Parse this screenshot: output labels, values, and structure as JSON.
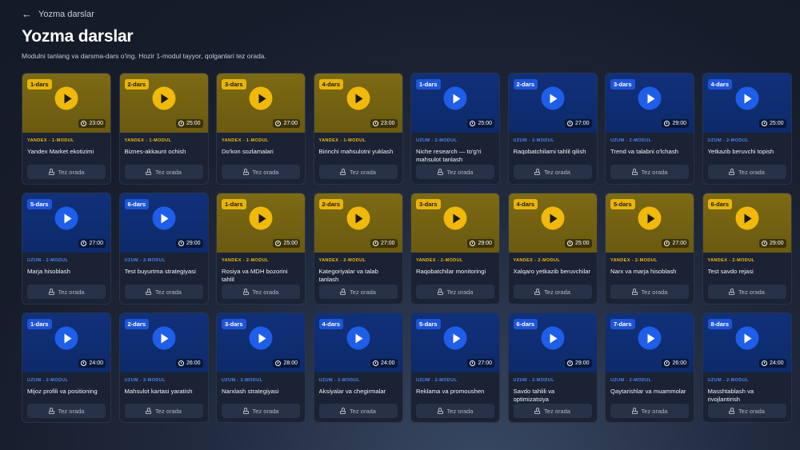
{
  "header": {
    "back_label": "Yozma darslar",
    "title": "Yozma darslar",
    "subtitle": "Modulni tanlang va darsma-dars o'ing. Hozir 1-modul tayyor, qolganlari tez orada."
  },
  "soon_label": "Tez orada",
  "colors": {
    "yandex": "#f0b90b",
    "uzum": "#1e5ee8"
  },
  "rows": [
    [
      {
        "badge": "1-dars",
        "brand": "yandex",
        "module": "YANDEX - 1-MODUL",
        "duration": "23:00",
        "title": "Yandex Market ekotizimi"
      },
      {
        "badge": "2-dars",
        "brand": "yandex",
        "module": "YANDEX - 1-MODUL",
        "duration": "25:00",
        "title": "Biznes-akkaunt ochish"
      },
      {
        "badge": "3-dars",
        "brand": "yandex",
        "module": "YANDEX - 1-MODUL",
        "duration": "27:00",
        "title": "Do'kon sozlamalari"
      },
      {
        "badge": "4-dars",
        "brand": "yandex",
        "module": "YANDEX - 1-MODUL",
        "duration": "23:00",
        "title": "Birinchi mahsulotni yuklash"
      },
      {
        "badge": "1-dars",
        "brand": "uzum",
        "module": "UZUM - 2-MODUL",
        "duration": "25:00",
        "title": "Niche research — to'g'ri mahsulot tanlash"
      },
      {
        "badge": "2-dars",
        "brand": "uzum",
        "module": "UZUM - 2-MODUL",
        "duration": "27:00",
        "title": "Raqobatchilarni tahlil qilish"
      },
      {
        "badge": "3-dars",
        "brand": "uzum",
        "module": "UZUM - 2-MODUL",
        "duration": "29:00",
        "title": "Trend va talabni o'lchash"
      },
      {
        "badge": "4-dars",
        "brand": "uzum",
        "module": "UZUM - 2-MODUL",
        "duration": "25:00",
        "title": "Yetkazib beruvchi topish"
      }
    ],
    [
      {
        "badge": "5-dars",
        "brand": "uzum",
        "module": "UZUM - 2-MODUL",
        "duration": "27:00",
        "title": "Marja hisoblash"
      },
      {
        "badge": "6-dars",
        "brand": "uzum",
        "module": "UZUM - 2-MODUL",
        "duration": "29:00",
        "title": "Test buyurtma strategiyasi"
      },
      {
        "badge": "1-dars",
        "brand": "yandex",
        "module": "YANDEX - 2-MODUL",
        "duration": "25:00",
        "title": "Rosiya va MDH bozorini tahlil"
      },
      {
        "badge": "2-dars",
        "brand": "yandex",
        "module": "YANDEX - 2-MODUL",
        "duration": "27:00",
        "title": "Kategoriyalar va talab tanlash"
      },
      {
        "badge": "3-dars",
        "brand": "yandex",
        "module": "YANDEX - 2-MODUL",
        "duration": "29:00",
        "title": "Raqobatchilar monitoringi"
      },
      {
        "badge": "4-dars",
        "brand": "yandex",
        "module": "YANDEX - 2-MODUL",
        "duration": "25:00",
        "title": "Xalqaro yetkazib beruvchilar"
      },
      {
        "badge": "5-dars",
        "brand": "yandex",
        "module": "YANDEX - 2-MODUL",
        "duration": "27:00",
        "title": "Narx va marja hisoblash"
      },
      {
        "badge": "6-dars",
        "brand": "yandex",
        "module": "YANDEX - 2-MODUL",
        "duration": "29:00",
        "title": "Test savdo rejasi"
      }
    ],
    [
      {
        "badge": "1-dars",
        "brand": "uzum",
        "module": "UZUM - 2-MODUL",
        "duration": "24:00",
        "title": "Mijoz profili va positioning"
      },
      {
        "badge": "2-dars",
        "brand": "uzum",
        "module": "UZUM - 2-MODUL",
        "duration": "26:00",
        "title": "Mahsulot kartasi yaratish"
      },
      {
        "badge": "3-dars",
        "brand": "uzum",
        "module": "UZUM - 2-MODUL",
        "duration": "28:00",
        "title": "Narxlash strategiyasi"
      },
      {
        "badge": "4-dars",
        "brand": "uzum",
        "module": "UZUM - 2-MODUL",
        "duration": "24:00",
        "title": "Aksiyalar va chegirmalar"
      },
      {
        "badge": "5-dars",
        "brand": "uzum",
        "module": "UZUM - 2-MODUL",
        "duration": "27:00",
        "title": "Reklama va promoushen"
      },
      {
        "badge": "6-dars",
        "brand": "uzum",
        "module": "UZUM - 2-MODUL",
        "duration": "29:00",
        "title": "Savdo tahlili va optimizatsiya"
      },
      {
        "badge": "7-dars",
        "brand": "uzum",
        "module": "UZUM - 2-MODUL",
        "duration": "26:00",
        "title": "Qaytarishlar va muammolar"
      },
      {
        "badge": "8-dars",
        "brand": "uzum",
        "module": "UZUM - 2-MODUL",
        "duration": "24:00",
        "title": "Masshtablash va rivojlantirish"
      }
    ]
  ]
}
